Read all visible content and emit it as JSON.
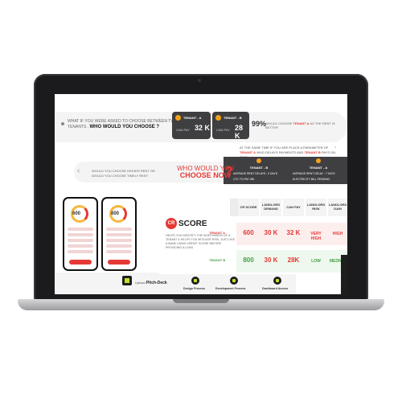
{
  "question1": {
    "line1": "WHAT IF YOU WERE ASKED TO CHOOSE BETWEEN TWO",
    "line2_prefix": "TENANTS ,",
    "emphasis": "WHO WOULD YOU CHOOSE ?"
  },
  "tenant_cards": [
    {
      "name": "TENANT - A",
      "label": "CAN PAY",
      "value": "32 K"
    },
    {
      "name": "TENANT - B",
      "label": "CAN PAY",
      "value": "28 K"
    }
  ],
  "verdict": {
    "percent": "99%",
    "text_prefix": "WOULD CHOOSE",
    "highlight": "TENANT A",
    "text_suffix": "AS THE RENT IS BETTER"
  },
  "note2": {
    "prefix": "AT THE SAME TIME IF YOU ARE PLACE A PARAMETER OF",
    "highlight1": "TENANT A",
    "middle": "WHO DELAYS PAYMENTS AND",
    "highlight2": "TENANT B",
    "suffix": "PAYS ON TIME"
  },
  "dark_cards": [
    {
      "name": "TENANT - B",
      "line1": "AVERAGE RENT DELAYS : 0 DAYS",
      "line2": "CTC TO PAY 28K"
    },
    {
      "name": "TENANT - A",
      "line1": "AVERAGE RENT DELAY : 7 DAYS",
      "line2": "ELECTRICITY BILL PENDING"
    }
  ],
  "question2": {
    "line1": "WOULD YOU CHOOSE HIGHER RENT OR",
    "line2": "WOULD YOU CHOOSE TIMELY RENT",
    "title1": "WHO WOULD YOU",
    "title2": "CHOOSE NOW",
    "qmark": "?"
  },
  "phones": [
    {
      "score": "600"
    },
    {
      "score": "800"
    }
  ],
  "score_section": {
    "logo": "CR",
    "title": "SCORE",
    "description": "HELPS YOU IDENTIFY THE WORTHINESS OF A TENANT & HELPS YOU MITIGATE RISK, JUST LIKE A BANK USING CREDIT SCORE BEFORE PROVIDING A LOAN"
  },
  "table": {
    "headers": [
      "CR SCORE",
      "LANDLORD DEMAND",
      "CAN PAY",
      "LANDLORD RISK",
      "LANDLORD GAIN"
    ],
    "rows": [
      {
        "label": "TENANT A",
        "score": "600",
        "demand": "30 K",
        "can_pay": "32 K",
        "risk": "VERY HIGH",
        "gain": "HIGH"
      },
      {
        "label": "TENANT B",
        "score": "800",
        "demand": "30 K",
        "can_pay": "28K",
        "risk": "LOW",
        "gain": "MEDIUM"
      }
    ]
  },
  "bottom_bar": {
    "upload_prefix": "Upload",
    "upload_bold": "Pitch-Deck",
    "nav": [
      "Design Process",
      "Development Process",
      "Dashboard Access"
    ]
  },
  "colors": {
    "accent_red": "#e53935",
    "accent_green": "#43a047",
    "card_dark": "#3f3f42",
    "coin": "#f3a21b",
    "nav_lime": "#c6e02a"
  }
}
